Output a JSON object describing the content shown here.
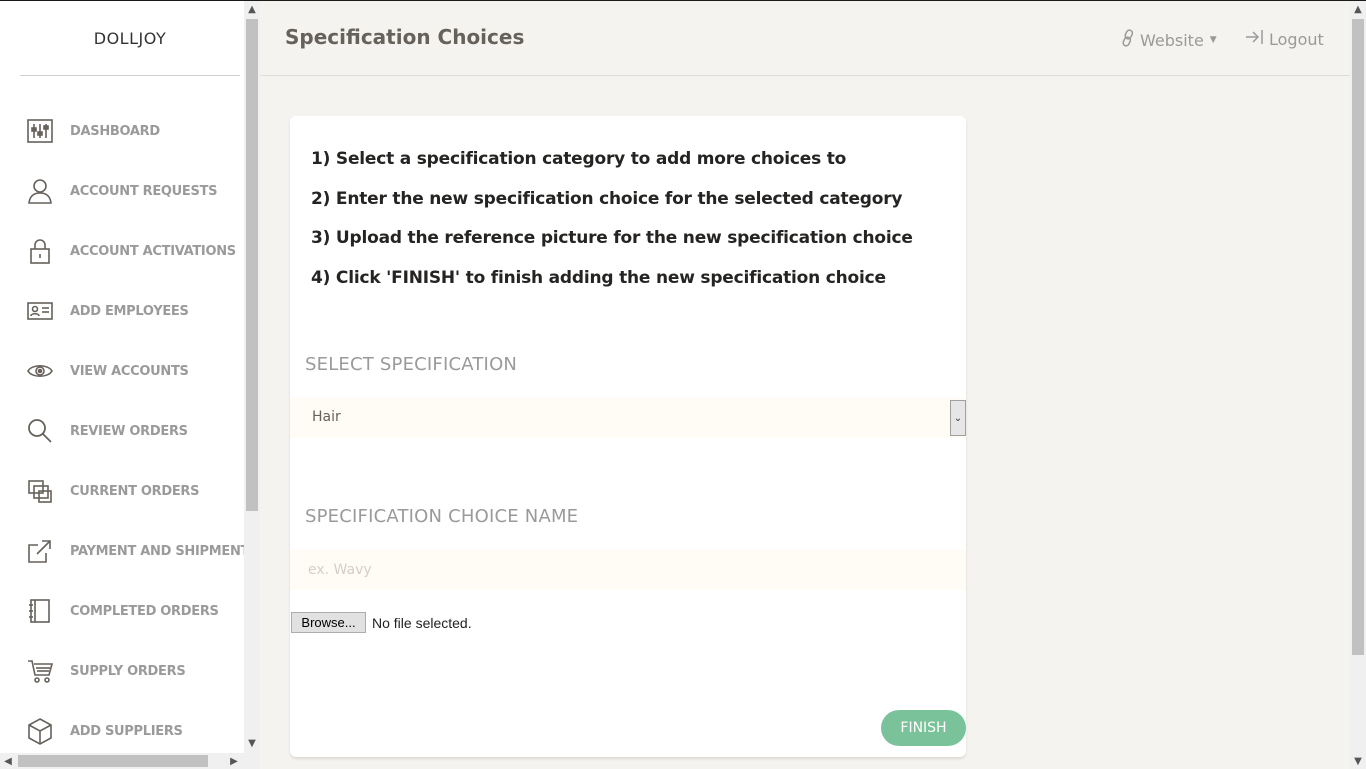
{
  "brand": "DOLLJOY",
  "header": {
    "title": "Specification Choices",
    "website_label": "Website",
    "logout_label": "Logout"
  },
  "sidebar": {
    "items": [
      {
        "label": "DASHBOARD",
        "icon": "dashboard-icon"
      },
      {
        "label": "ACCOUNT REQUESTS",
        "icon": "user-icon"
      },
      {
        "label": "ACCOUNT ACTIVATIONS",
        "icon": "lock-icon"
      },
      {
        "label": "ADD EMPLOYEES",
        "icon": "id-card-icon"
      },
      {
        "label": "VIEW ACCOUNTS",
        "icon": "eye-icon"
      },
      {
        "label": "REVIEW ORDERS",
        "icon": "search-icon"
      },
      {
        "label": "CURRENT ORDERS",
        "icon": "copy-icon"
      },
      {
        "label": "PAYMENT AND SHIPMENT",
        "icon": "external-link-icon"
      },
      {
        "label": "COMPLETED ORDERS",
        "icon": "notebook-icon"
      },
      {
        "label": "SUPPLY ORDERS",
        "icon": "cart-icon"
      },
      {
        "label": "ADD SUPPLIERS",
        "icon": "box-icon"
      }
    ]
  },
  "card": {
    "steps": [
      "1) Select a specification category to add more choices to",
      "2) Enter the new specification choice for the selected category",
      "3) Upload the reference picture for the new specification choice",
      "4) Click 'FINISH' to finish adding the new specification choice"
    ],
    "select_label": "SELECT SPECIFICATION",
    "select_value": "Hair",
    "choice_label": "SPECIFICATION CHOICE NAME",
    "choice_placeholder": "ex. Wavy",
    "browse_label": "Browse...",
    "file_status": "No file selected.",
    "finish_label": "FINISH"
  },
  "colors": {
    "background": "#f4f3ef",
    "accent_success": "#7ac29a",
    "muted_text": "#9a9a9a",
    "input_bg": "#fffcf5"
  }
}
